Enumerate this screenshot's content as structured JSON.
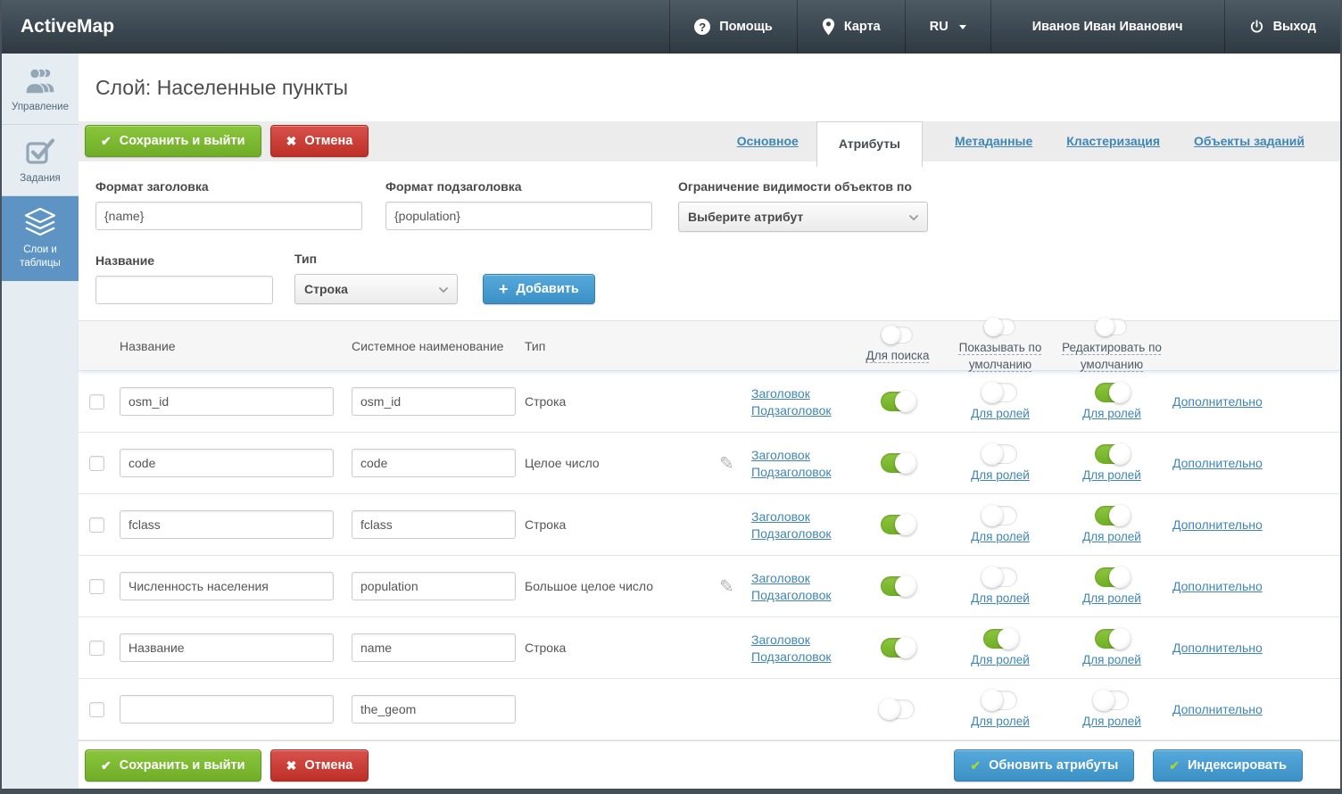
{
  "topbar": {
    "logo": "ActiveMap",
    "help": "Помощь",
    "map": "Карта",
    "lang": "RU",
    "user": "Иванов Иван Иванович",
    "logout": "Выход"
  },
  "sidebar": {
    "items": [
      {
        "label": "Управление",
        "icon": "users-icon",
        "active": false
      },
      {
        "label": "Задания",
        "icon": "tasks-icon",
        "active": false
      },
      {
        "label": "Слои и таблицы",
        "icon": "layers-icon",
        "active": true
      }
    ]
  },
  "page": {
    "title": "Слой: Населенные пункты"
  },
  "toolbar": {
    "save_label": "Сохранить и выйти",
    "cancel_label": "Отмена"
  },
  "tabs": [
    {
      "label": "Основное",
      "active": false
    },
    {
      "label": "Атрибуты",
      "active": true
    },
    {
      "label": "Метаданные",
      "active": false
    },
    {
      "label": "Кластеризация",
      "active": false
    },
    {
      "label": "Объекты заданий",
      "active": false
    }
  ],
  "form": {
    "title_format": {
      "label": "Формат заголовка",
      "value": "{name}"
    },
    "subtitle_format": {
      "label": "Формат подзаголовка",
      "value": "{population}"
    },
    "visibility": {
      "label": "Ограничение видимости объектов по",
      "value": "Выберите атрибут"
    },
    "name": {
      "label": "Название",
      "value": ""
    },
    "type": {
      "label": "Тип",
      "value": "Строка"
    },
    "add_label": "Добавить"
  },
  "table": {
    "headers": {
      "name": "Название",
      "system_name": "Системное наименование",
      "type": "Тип",
      "search": "Для поиска",
      "show_default": "Показывать по умолчанию",
      "edit_default": "Редактировать по умолчанию"
    },
    "links": {
      "header": "Заголовок",
      "subheader": "Подзаголовок",
      "for_roles": "Для ролей",
      "more": "Дополнительно"
    },
    "rows": [
      {
        "name": "osm_id",
        "system_name": "osm_id",
        "type": "Строка",
        "has_pencil": false,
        "has_header_links": true,
        "search_on": true,
        "show_default_on": false,
        "edit_default_on": true
      },
      {
        "name": "code",
        "system_name": "code",
        "type": "Целое число",
        "has_pencil": true,
        "has_header_links": true,
        "search_on": true,
        "show_default_on": false,
        "edit_default_on": true
      },
      {
        "name": "fclass",
        "system_name": "fclass",
        "type": "Строка",
        "has_pencil": false,
        "has_header_links": true,
        "search_on": true,
        "show_default_on": false,
        "edit_default_on": true
      },
      {
        "name": "Численность населения",
        "system_name": "population",
        "type": "Большое целое число",
        "has_pencil": true,
        "has_header_links": true,
        "search_on": true,
        "show_default_on": false,
        "edit_default_on": true
      },
      {
        "name": "Название",
        "system_name": "name",
        "type": "Строка",
        "has_pencil": false,
        "has_header_links": true,
        "search_on": true,
        "show_default_on": true,
        "edit_default_on": true
      },
      {
        "name": "",
        "system_name": "the_geom",
        "type": "",
        "has_pencil": false,
        "has_header_links": false,
        "search_on": false,
        "show_default_on": false,
        "edit_default_on": false
      }
    ]
  },
  "footer": {
    "update_label": "Обновить атрибуты",
    "index_label": "Индексировать"
  },
  "colors": {
    "topbar": "#39444d",
    "sidebar_active": "#5e94c3",
    "green_button": "#7cb32c",
    "red_button": "#c4332b",
    "blue_button": "#3f94c9",
    "link": "#3e86b4",
    "toggle_on": "#7cb82f"
  }
}
